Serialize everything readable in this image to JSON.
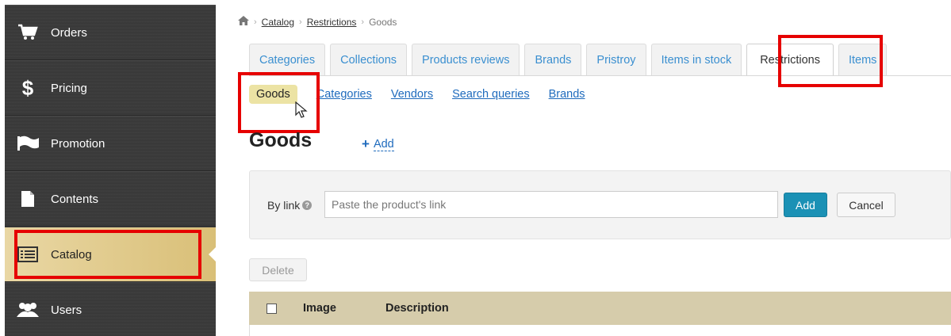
{
  "sidebar": {
    "items": [
      {
        "label": "Orders",
        "icon": "cart-icon"
      },
      {
        "label": "Pricing",
        "icon": "dollar-icon"
      },
      {
        "label": "Promotion",
        "icon": "flag-icon"
      },
      {
        "label": "Contents",
        "icon": "document-icon"
      },
      {
        "label": "Catalog",
        "icon": "list-icon",
        "active": true
      },
      {
        "label": "Users",
        "icon": "users-icon"
      }
    ]
  },
  "breadcrumb": {
    "home_icon": "home-icon",
    "items": [
      "Catalog",
      "Restrictions",
      "Goods"
    ]
  },
  "tabs": [
    {
      "label": "Categories"
    },
    {
      "label": "Collections"
    },
    {
      "label": "Products reviews"
    },
    {
      "label": "Brands"
    },
    {
      "label": "Pristroy"
    },
    {
      "label": "Items in stock"
    },
    {
      "label": "Restrictions",
      "active": true
    },
    {
      "label": "Items"
    }
  ],
  "subnav": {
    "items": [
      {
        "label": "Goods",
        "active": true
      },
      {
        "label": "Categories"
      },
      {
        "label": "Vendors"
      },
      {
        "label": "Search queries"
      },
      {
        "label": "Brands"
      }
    ]
  },
  "page": {
    "title": "Goods",
    "add_label": "Add"
  },
  "form": {
    "by_link_label": "By link",
    "input_placeholder": "Paste the product's link",
    "input_value": "",
    "add_button": "Add",
    "cancel_button": "Cancel"
  },
  "actions": {
    "delete_button": "Delete"
  },
  "table": {
    "columns": [
      "Image",
      "Description"
    ]
  },
  "colors": {
    "sidebar_bg": "#3a3a3a",
    "sidebar_active": "#e1c98a",
    "tab_link": "#3a8fd0",
    "link": "#1f6bbd",
    "primary_button": "#1b91b5",
    "table_header": "#d6ccab",
    "highlight": "#e60000",
    "subnav_pill": "#ece3a4"
  }
}
